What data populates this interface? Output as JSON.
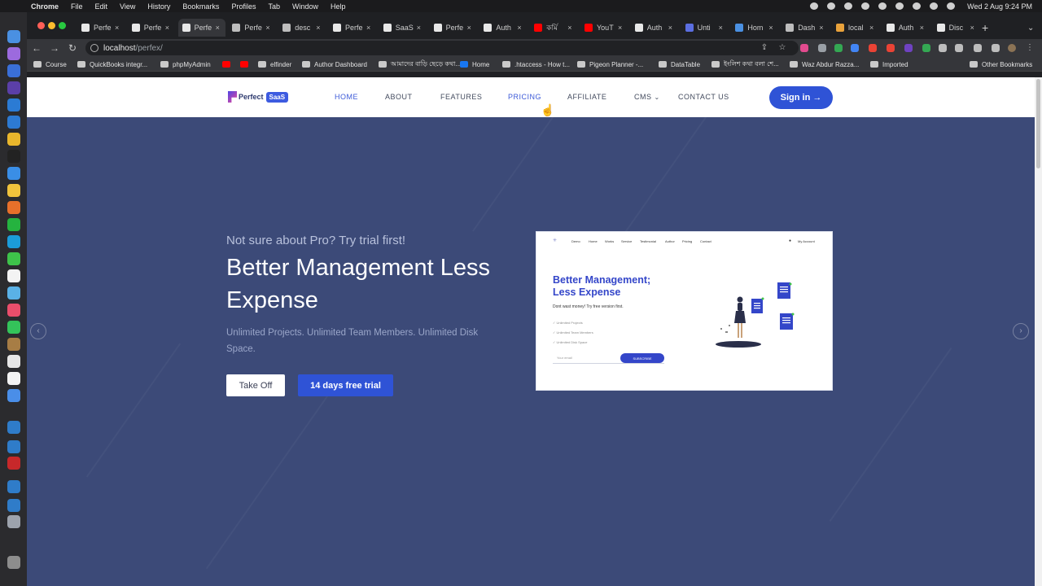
{
  "menubar": {
    "app": "Chrome",
    "items": [
      "File",
      "Edit",
      "View",
      "History",
      "Bookmarks",
      "Profiles",
      "Tab",
      "Window",
      "Help"
    ],
    "clock": "Wed 2 Aug  9:24 PM"
  },
  "tabs": [
    {
      "title": "Perfe",
      "active": false
    },
    {
      "title": "Perfe",
      "active": false
    },
    {
      "title": "Perfe",
      "active": true
    },
    {
      "title": "Perfe",
      "active": false
    },
    {
      "title": "desc",
      "active": false
    },
    {
      "title": "Perfe",
      "active": false
    },
    {
      "title": "SaaS",
      "active": false
    },
    {
      "title": "Perfe",
      "active": false
    },
    {
      "title": "Auth",
      "active": false
    },
    {
      "title": "কর্মি",
      "active": false
    },
    {
      "title": "YouT",
      "active": false
    },
    {
      "title": "Auth",
      "active": false
    },
    {
      "title": "Unti",
      "active": false
    },
    {
      "title": "Hom",
      "active": false
    },
    {
      "title": "Dash",
      "active": false
    },
    {
      "title": "local",
      "active": false
    },
    {
      "title": "Auth",
      "active": false
    },
    {
      "title": "Disc",
      "active": false
    }
  ],
  "address": {
    "host": "localhost",
    "path": "/perfex/"
  },
  "bookmarks": [
    "Course",
    "QuickBooks integr...",
    "phpMyAdmin",
    "",
    "",
    "elfinder",
    "Author Dashboard",
    "আমাদের বাড়ি ছেড়ে কথা...",
    "Home",
    ".htaccess - How t...",
    "Pigeon Planner -...",
    "DataTable",
    "ইংলিশ কথা বলা শে...",
    "Waz Abdur Razza...",
    "Imported",
    "Other Bookmarks"
  ],
  "site": {
    "logo": {
      "word": "Perfect",
      "badge": "SaaS"
    },
    "nav": [
      {
        "label": "HOME",
        "active": true
      },
      {
        "label": "ABOUT",
        "active": false
      },
      {
        "label": "FEATURES",
        "active": false
      },
      {
        "label": "PRICING",
        "active": true
      },
      {
        "label": "AFFILIATE",
        "active": false
      },
      {
        "label": "CMS",
        "active": false
      },
      {
        "label": "CONTACT US",
        "active": false
      }
    ],
    "signin": "Sign in →"
  },
  "hero": {
    "kicker": "Not sure about Pro? Try trial first!",
    "headline": "Better Management Less Expense",
    "tagline": "Unlimited Projects. Unlimited Team Members. Unlimited Disk Space.",
    "btn_primary": "Take Off",
    "btn_secondary": "14 days free trial"
  },
  "preview": {
    "nav": [
      "Demo",
      "Home",
      "Works",
      "Service",
      "Testimonial",
      "Author",
      "Pricing",
      "Contact"
    ],
    "account": "My Account",
    "title": "Better Management; Less Expense",
    "subtitle": "Dont wast money! Try free version first.",
    "checks": [
      "Unlimited Projects",
      "Unlimited Team Members",
      "Unlimited Disk Space"
    ],
    "email_placeholder": "Your email",
    "subscribe": "SUBSCRIBE"
  },
  "colors": {
    "accent": "#2f53d6",
    "hero_bg": "#3c4a78"
  }
}
